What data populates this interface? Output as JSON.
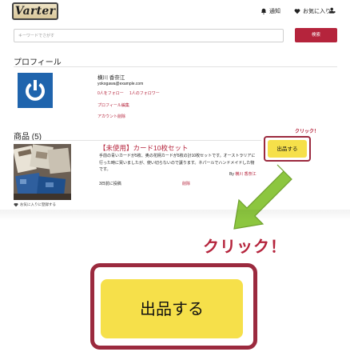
{
  "header": {
    "logo_text": "Varter",
    "nav": {
      "notifications_label": "通知",
      "favorites_label": "お気に入り"
    }
  },
  "search": {
    "placeholder": "キーワードでさがす",
    "button_label": "検索"
  },
  "profile": {
    "section_title": "プロフィール",
    "name": "横川 香奈江",
    "email": "yokogawa@example.com",
    "following_label": "0人をフォロー",
    "followers_label": "1人のフォロワー",
    "edit_link": "プロフィール編集",
    "delete_account_link": "アカウント削除"
  },
  "products": {
    "section_title": "商品 (5)",
    "items": [
      {
        "title": "【未使用】カード10枚セット",
        "description": "手前の青いカードが5枚、奥の花柄カードが5枚の計10枚セットです。オーストラリアに行った時に買いましたが、使い切らないので譲ります。ネパールでハンドメイドした物です。",
        "by_prefix": "By",
        "by_user": "横川 香奈江",
        "posted": "3日前に投稿",
        "delete_label": "削除",
        "favorite_register": "お気に入りに登録する"
      }
    ]
  },
  "callout": {
    "small_click_label": "クリック！",
    "small_sell_label": "出品する",
    "big_click_label": "クリック！",
    "big_sell_label": "出品する"
  },
  "colors": {
    "accent": "#b5243c",
    "sell_button": "#f6e04a",
    "arrow": "#8cc63f",
    "avatar_bg": "#1f64ad"
  }
}
